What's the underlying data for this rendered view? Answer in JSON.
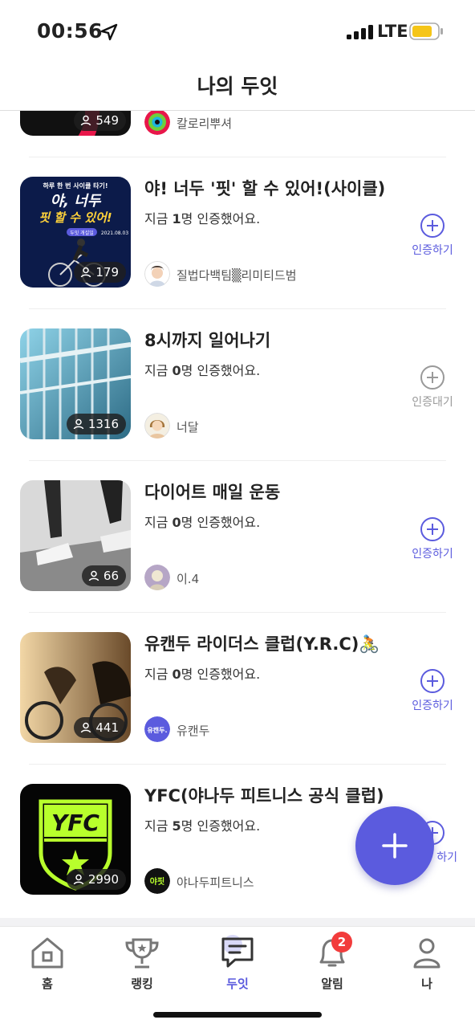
{
  "status": {
    "time": "00:56",
    "network": "LTE"
  },
  "header": {
    "title": "나의 두잇"
  },
  "colors": {
    "accent": "#5b5bde",
    "inactive": "#999999",
    "badge": "#f23c3c",
    "battery": "#f5c518"
  },
  "items": [
    {
      "title": "",
      "count_prefix": "",
      "count_bold": "",
      "count_suffix": "",
      "members": "549",
      "owner": "칼로리뿌셔",
      "action": "",
      "action_icon": ""
    },
    {
      "title": "야! 너두 '핏' 할 수 있어!(사이클)",
      "count_prefix": "지금 ",
      "count_bold": "1",
      "count_suffix": "명 인증했어요.",
      "members": "179",
      "owner": "질법다백팀▒리미티드범",
      "action": "인증하기",
      "action_icon": "plus-circle-icon",
      "thumb_text_top": "하루 한 번 사이클 타기!",
      "thumb_text_main1": "야, 너두",
      "thumb_text_main2": "핏 할 수 있어!",
      "thumb_text_tag": "두잇 개설일",
      "thumb_text_date": "2021.08.03"
    },
    {
      "title": "8시까지 일어나기",
      "count_prefix": "지금 ",
      "count_bold": "0",
      "count_suffix": "명 인증했어요.",
      "members": "1316",
      "owner": "너달",
      "action": "인증대기",
      "action_icon": "plus-circle-icon"
    },
    {
      "title": "다이어트 매일 운동",
      "count_prefix": "지금 ",
      "count_bold": "0",
      "count_suffix": "명 인증했어요.",
      "members": "66",
      "owner": "이.4",
      "action": "인증하기",
      "action_icon": "plus-circle-icon"
    },
    {
      "title": "유캔두 라이더스 클럽(Y.R.C)🚴",
      "count_prefix": "지금 ",
      "count_bold": "0",
      "count_suffix": "명 인증했어요.",
      "members": "441",
      "owner": "유캔두",
      "owner_logo": "유캔두.",
      "action": "인증하기",
      "action_icon": "plus-circle-icon"
    },
    {
      "title": "YFC(야나두 피트니스 공식 클럽)",
      "count_prefix": "지금 ",
      "count_bold": "5",
      "count_suffix": "명 인증했어요.",
      "members": "2990",
      "owner": "야나두피트니스",
      "owner_logo": "야핏",
      "thumb_text": "YFC",
      "action": "하기",
      "action_icon": "plus-circle-icon"
    }
  ],
  "tabs": [
    {
      "label": "홈",
      "icon": "home-icon"
    },
    {
      "label": "랭킹",
      "icon": "trophy-icon"
    },
    {
      "label": "두잇",
      "icon": "chat-icon",
      "active": true
    },
    {
      "label": "알림",
      "icon": "bell-icon",
      "badge": "2"
    },
    {
      "label": "나",
      "icon": "person-icon"
    }
  ]
}
